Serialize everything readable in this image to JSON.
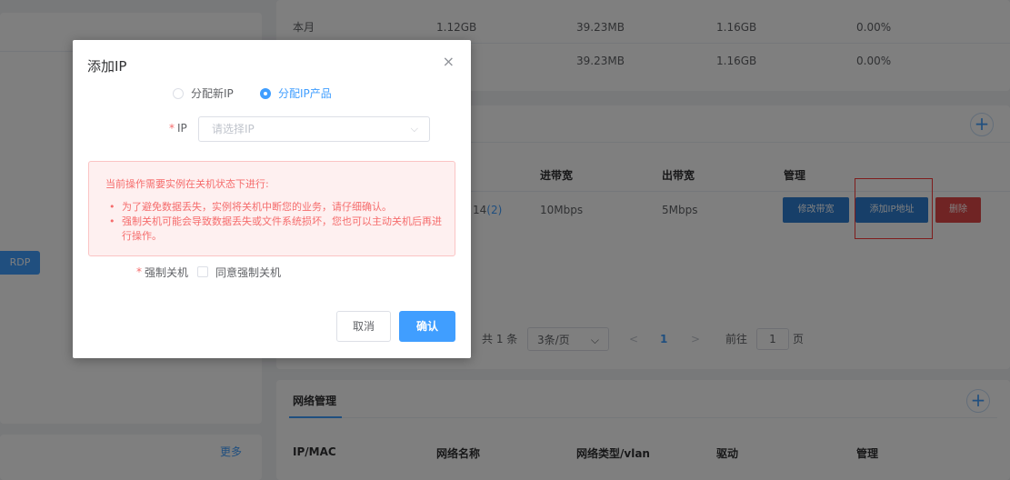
{
  "left": {
    "rdp_label": "RDP",
    "more_label": "更多"
  },
  "traffic": {
    "rows": [
      {
        "label": "本月",
        "c1": "1.12GB",
        "c2": "39.23MB",
        "c3": "1.16GB",
        "c4": "0.00%"
      },
      {
        "label": "",
        "c1": "",
        "c2": "39.23MB",
        "c3": "1.16GB",
        "c4": "0.00%"
      }
    ]
  },
  "bandwidth": {
    "headers": {
      "in": "进带宽",
      "out": "出带宽",
      "manage": "管理"
    },
    "row": {
      "ip_suffix": "14",
      "count": "(2)",
      "in": "10Mbps",
      "out": "5Mbps"
    },
    "buttons": {
      "modify": "修改带宽",
      "add_ip": "添加IP地址",
      "delete": "删除"
    },
    "pager": {
      "total": "共 1 条",
      "page_size": "3条/页",
      "prev": "<",
      "page": "1",
      "next": ">",
      "goto": "前往",
      "goto_value": "1",
      "page_unit": "页"
    }
  },
  "network": {
    "tab": "网络管理",
    "headers": [
      "IP/MAC",
      "网络名称",
      "网络类型/vlan",
      "驱动",
      "管理"
    ]
  },
  "dialog": {
    "title": "添加IP",
    "close": "×",
    "radio_new": "分配新IP",
    "radio_product": "分配IP产品",
    "ip_label": "IP",
    "ip_placeholder": "请选择IP",
    "warning_title": "当前操作需要实例在关机状态下进行:",
    "warning_items": [
      "为了避免数据丢失，实例将关机中断您的业务，请仔细确认。",
      "强制关机可能会导致数据丢失或文件系统损坏，您也可以主动关机后再进行操作。"
    ],
    "force_label": "强制关机",
    "force_checkbox": "同意强制关机",
    "cancel": "取消",
    "confirm": "确认"
  },
  "colors": {
    "primary": "#409eff",
    "danger": "#f56c6c"
  }
}
